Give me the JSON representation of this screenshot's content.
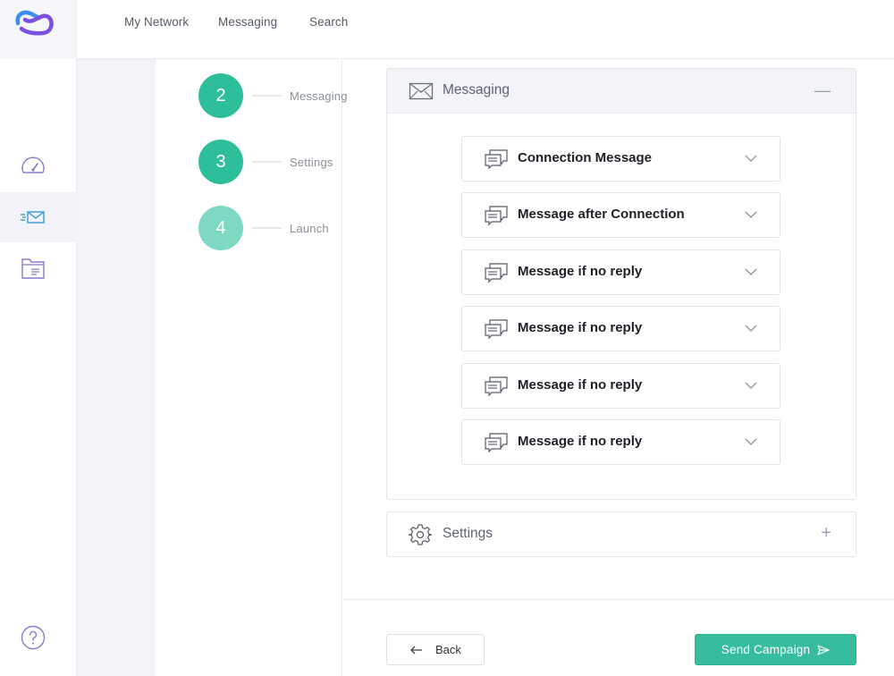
{
  "colors": {
    "accent": "#35bd9e",
    "step_done": "#2ebf9a",
    "step_pending": "#7fd9c2",
    "rail_icon": "#8a79c9",
    "logo_blue": "#3a8ff0",
    "logo_purple": "#7b4fe0"
  },
  "nav": {
    "items": [
      {
        "label": "My Network"
      },
      {
        "label": "Messaging"
      },
      {
        "label": "Search"
      }
    ]
  },
  "rail": {
    "icons": [
      "speedometer-icon",
      "send-mail-icon",
      "folder-icon",
      "help-icon"
    ],
    "active": "send-mail-icon"
  },
  "steps": [
    {
      "number": "2",
      "label": "Messaging",
      "state": "done"
    },
    {
      "number": "3",
      "label": "Settings",
      "state": "done"
    },
    {
      "number": "4",
      "label": "Launch",
      "state": "pending"
    }
  ],
  "messaging_panel": {
    "title": "Messaging",
    "toggle": "—",
    "items": [
      {
        "label": "Connection Message"
      },
      {
        "label": "Message after Connection"
      },
      {
        "label": "Message if no reply"
      },
      {
        "label": "Message if no reply"
      },
      {
        "label": "Message if no reply"
      },
      {
        "label": "Message if no reply"
      }
    ]
  },
  "settings_panel": {
    "title": "Settings",
    "toggle": "+"
  },
  "footer": {
    "back_label": "Back",
    "send_label": "Send Campaign"
  }
}
